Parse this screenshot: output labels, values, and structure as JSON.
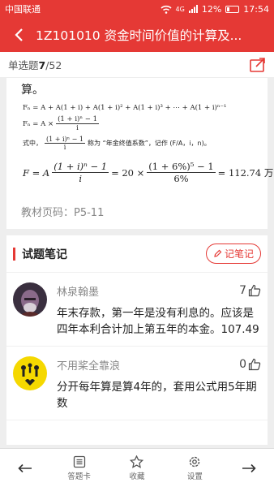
{
  "status": {
    "carrier": "中国联通",
    "signal": "4G",
    "battery": "12%",
    "time": "17:54"
  },
  "appbar": {
    "title": "1Z101010 资金时间价值的计算及..."
  },
  "question": {
    "type_label": "单选题",
    "current": "7",
    "total": "/52"
  },
  "content": {
    "continued": "算。",
    "line1": "Fₙ = A + A(1 + i) + A(1 + i)² + A(1 + i)³ + ⋯ + A(1 + i)ⁿ⁻¹",
    "line2_prefix": "Fₙ = A ×",
    "line2_num": "(1 + i)ⁿ − 1",
    "line2_den": "i",
    "line3_prefix": "式中，",
    "line3_num": "(1 + i)ⁿ − 1",
    "line3_den": "i",
    "line3_suffix": "称为 “年金终值系数”，记作 (F/A，i，n)。",
    "calc_prefix": "F = A",
    "calc_num1": "(1 + i)ⁿ − 1",
    "calc_den1": "i",
    "calc_mid": "= 20 ×",
    "calc_num2": "(1 + 6%)⁵ − 1",
    "calc_den2": "6%",
    "calc_result": "= 112.74 万元",
    "source": "教材页码：P5-11"
  },
  "notes": {
    "title": "试题笔记",
    "write_button": "记笔记",
    "items": [
      {
        "name": "林泉翰墨",
        "likes": "7",
        "text": "年末存款，第一年是没有利息的。应该是四年本利合计加上第五年的本金。107.49"
      },
      {
        "name": "不用桨全靠浪",
        "likes": "0",
        "text": "分开每年算是算4年的，套用公式用5年期数"
      }
    ]
  },
  "bottom": {
    "answer_card": "答题卡",
    "favorite": "收藏",
    "settings": "设置"
  },
  "colors": {
    "accent": "#e53935"
  }
}
